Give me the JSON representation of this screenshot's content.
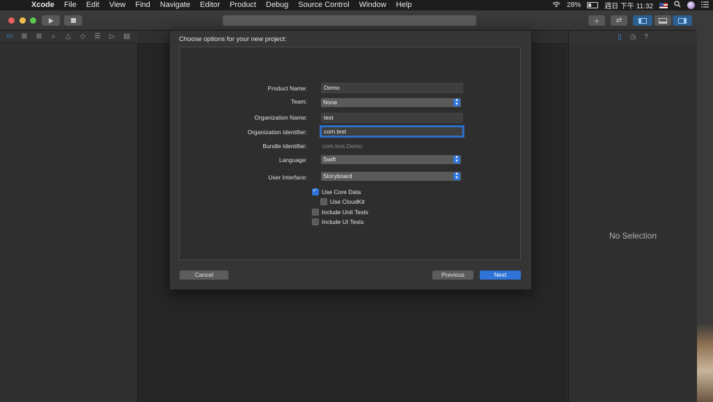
{
  "menubar": {
    "app_name": "Xcode",
    "items": [
      "File",
      "Edit",
      "View",
      "Find",
      "Navigate",
      "Editor",
      "Product",
      "Debug",
      "Source Control",
      "Window",
      "Help"
    ],
    "battery": "28%",
    "clock": "週日 下午 11:32"
  },
  "sheet": {
    "title": "Choose options for your new project:",
    "fields": {
      "product_name_label": "Product Name:",
      "product_name_value": "Demo",
      "team_label": "Team:",
      "team_value": "None",
      "org_name_label": "Organization Name:",
      "org_name_value": "test",
      "org_id_label": "Organization Identifier:",
      "org_id_value": "com.test",
      "bundle_id_label": "Bundle Identifier:",
      "bundle_id_value": "com.test.Demo",
      "language_label": "Language:",
      "language_value": "Swift",
      "ui_label": "User Interface:",
      "ui_value": "Storyboard"
    },
    "checkboxes": {
      "core_data": "Use Core Data",
      "cloudkit": "Use CloudKit",
      "unit_tests": "Include Unit Tests",
      "ui_tests": "Include UI Tests"
    },
    "buttons": {
      "cancel": "Cancel",
      "previous": "Previous",
      "next": "Next"
    }
  },
  "inspector": {
    "no_selection": "No Selection"
  },
  "colors": {
    "accent": "#2f74d8",
    "traffic_red": "#ec5f58",
    "traffic_yellow": "#f4bd4f",
    "traffic_green": "#5ec94f"
  }
}
